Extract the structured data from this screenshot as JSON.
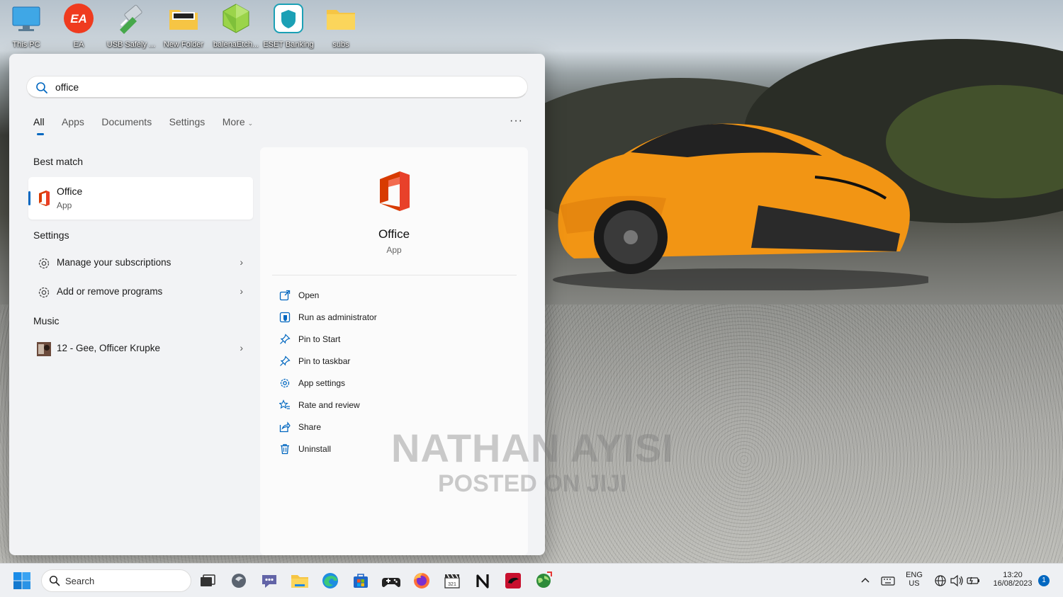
{
  "desktop": {
    "icons": [
      {
        "label": "This PC",
        "icon": "monitor-icon"
      },
      {
        "label": "EA",
        "icon": "ea-app-icon"
      },
      {
        "label": "USB Safely ...",
        "icon": "usb-icon"
      },
      {
        "label": "New Folder",
        "icon": "folder-icon"
      },
      {
        "label": "balenaEtch...",
        "icon": "balena-etcher-icon"
      },
      {
        "label": "ESET Banking",
        "icon": "eset-icon"
      },
      {
        "label": "subs",
        "icon": "folder-icon"
      }
    ]
  },
  "search": {
    "query": "office",
    "placeholder": ""
  },
  "filters": {
    "tabs": [
      "All",
      "Apps",
      "Documents",
      "Settings",
      "More"
    ],
    "active": "All",
    "more_icon": "ellipsis-icon"
  },
  "results": {
    "best_match_title": "Best match",
    "best_match": {
      "name": "Office",
      "type": "App"
    },
    "settings_title": "Settings",
    "settings": [
      {
        "label": "Manage your subscriptions",
        "icon": "gear-icon"
      },
      {
        "label": "Add or remove programs",
        "icon": "gear-icon"
      }
    ],
    "music_title": "Music",
    "music": [
      {
        "label": "12 - Gee, Officer Krupke",
        "icon": "album-art-icon"
      }
    ]
  },
  "preview": {
    "name": "Office",
    "type": "App",
    "actions": [
      {
        "label": "Open",
        "icon": "open-external-icon"
      },
      {
        "label": "Run as administrator",
        "icon": "shield-icon"
      },
      {
        "label": "Pin to Start",
        "icon": "pin-icon"
      },
      {
        "label": "Pin to taskbar",
        "icon": "pin-icon"
      },
      {
        "label": "App settings",
        "icon": "gear-icon"
      },
      {
        "label": "Rate and review",
        "icon": "star-icon"
      },
      {
        "label": "Share",
        "icon": "share-icon"
      },
      {
        "label": "Uninstall",
        "icon": "trash-icon"
      }
    ]
  },
  "watermark": {
    "line1": "NATHAN AYISI",
    "line2": "POSTED ON JIJI"
  },
  "taskbar": {
    "search_label": "Search",
    "language": "ENG",
    "region": "US",
    "time": "13:20",
    "date": "16/08/2023",
    "notification_count": "1"
  },
  "colors": {
    "accent": "#0067c0",
    "panel_bg": "#f2f3f5",
    "office_red": "#d83b01",
    "taskbar_bg": "#eef0f3"
  }
}
